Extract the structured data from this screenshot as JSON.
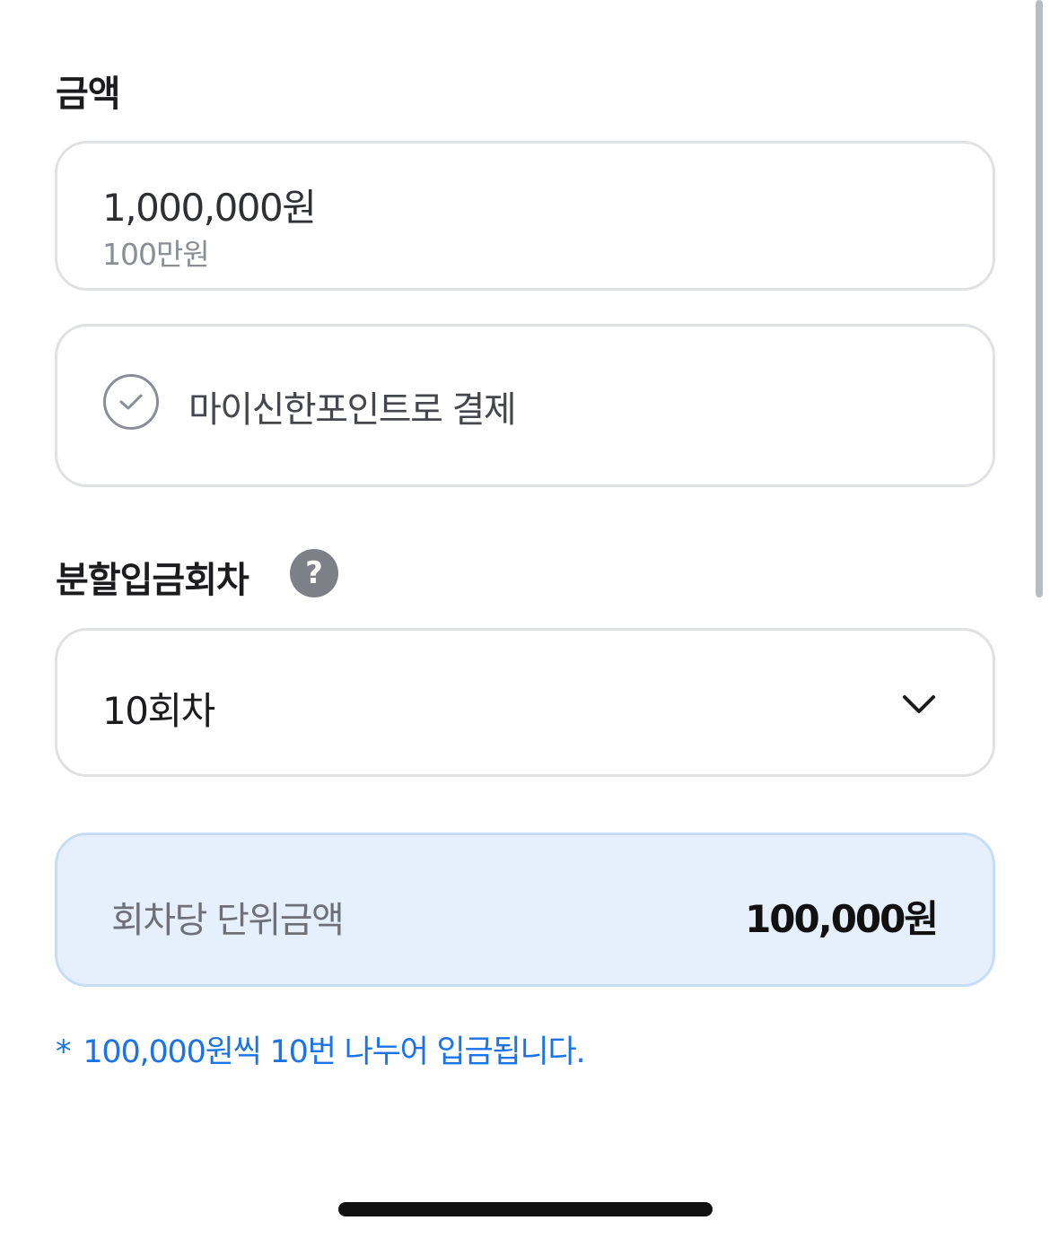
{
  "amount_section": {
    "title": "금액",
    "value": "1,000,000원",
    "sub": "100만원"
  },
  "point_option": {
    "label": "마이신한포인트로 결제",
    "icon": "check-circle-icon"
  },
  "installment_section": {
    "title": "분할입금회차",
    "help_icon": "?",
    "selected": "10회차"
  },
  "unit_amount": {
    "label": "회차당 단위금액",
    "value": "100,000원"
  },
  "note": {
    "star": "*",
    "text": "100,000원씩 10번 나누어 입금됩니다."
  },
  "colors": {
    "accent": "#1a73e8",
    "unit_card_bg": "#e6f0fc"
  }
}
